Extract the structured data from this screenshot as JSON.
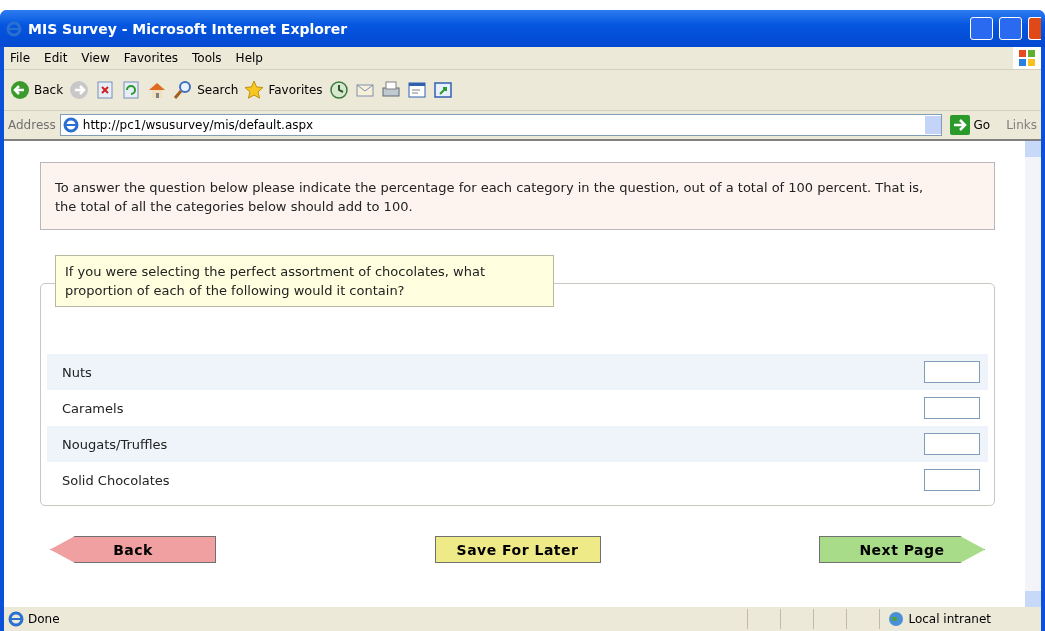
{
  "window": {
    "title": "MIS Survey - Microsoft Internet Explorer"
  },
  "menu": [
    "File",
    "Edit",
    "View",
    "Favorites",
    "Tools",
    "Help"
  ],
  "toolbar": [
    {
      "kind": "back",
      "label": "Back"
    },
    {
      "kind": "forward"
    },
    {
      "kind": "stop"
    },
    {
      "kind": "refresh"
    },
    {
      "kind": "home"
    },
    {
      "kind": "search",
      "label": "Search"
    },
    {
      "kind": "favorites",
      "label": "Favorites"
    },
    {
      "kind": "history"
    },
    {
      "kind": "mail"
    },
    {
      "kind": "print"
    },
    {
      "kind": "edit"
    },
    {
      "kind": "messenger"
    }
  ],
  "address": {
    "label": "Address",
    "url": "http://pc1/wsusurvey/mis/default.aspx",
    "go": "Go",
    "links": "Links"
  },
  "instructions": "To answer the question below please indicate the percentage for each category in the question, out of a total of 100 percent. That is, the total of all the categories below should add to 100.",
  "question": "If you were selecting the perfect assortment of chocolates, what proportion of each of the following would it contain?",
  "rows": [
    {
      "label": "Nuts"
    },
    {
      "label": "Caramels"
    },
    {
      "label": "Nougats/Truffles"
    },
    {
      "label": "Solid Chocolates"
    }
  ],
  "buttons": [
    {
      "kind": "back",
      "label": "Back"
    },
    {
      "kind": "save",
      "label": "Save For Later"
    },
    {
      "kind": "next",
      "label": "Next Page"
    }
  ],
  "status_bar": {
    "text": "Done",
    "zone": "Local intranet"
  }
}
